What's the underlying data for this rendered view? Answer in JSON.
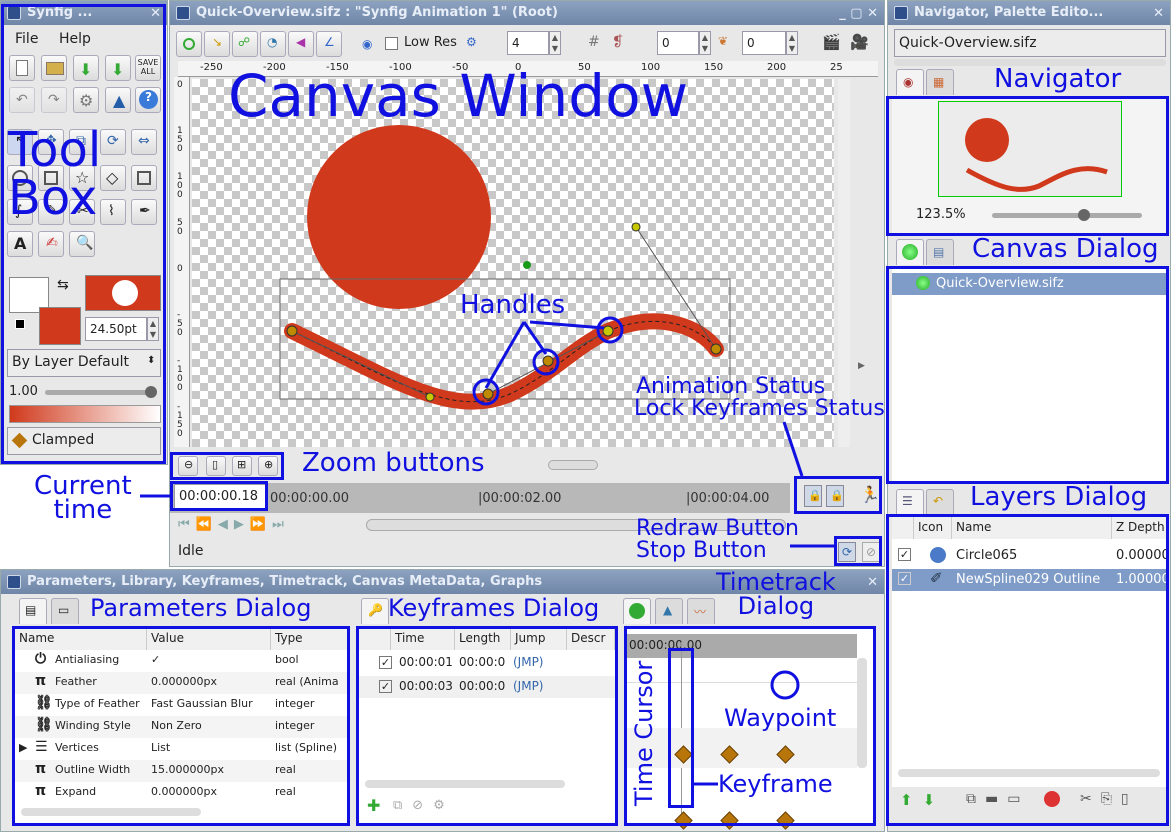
{
  "toolbox": {
    "title": "Synfig ...",
    "menu_file": "File",
    "menu_help": "Help",
    "save_all": "SAVE\nALL",
    "width": "24.50pt",
    "blend": "By Layer Default",
    "opacity": "1.00",
    "interp": "Clamped"
  },
  "canvas": {
    "title": "Quick-Overview.sifz : \"Synfig Animation 1\" (Root)",
    "low_res": "Low Res",
    "res_value": "4",
    "onion_past": "0",
    "onion_future": "0",
    "ruler_h": [
      "-250",
      "-200",
      "-150",
      "-100",
      "-50",
      "0",
      "50",
      "100",
      "150",
      "200",
      "25"
    ],
    "ruler_v": [
      "0",
      "150",
      "100",
      "50",
      "0",
      "-50",
      "-100",
      "-150"
    ],
    "current_time": "00:00:00.18",
    "time_ticks": [
      "00:00:00.00",
      "|00:00:02.00",
      "|00:00:04.00"
    ],
    "status": "Idle"
  },
  "navigator": {
    "title": "Navigator, Palette Edito...",
    "file": "Quick-Overview.sifz",
    "zoom": "123.5%"
  },
  "canvas_dialog": {
    "file": "Quick-Overview.sifz"
  },
  "layers": {
    "headers": [
      "Icon",
      "Name",
      "Z Depth"
    ],
    "rows": [
      {
        "name": "Circle065",
        "z": "0.00000"
      },
      {
        "name": "NewSpline029 Outline",
        "z": "1.00000"
      }
    ]
  },
  "params": {
    "title": "Parameters, Library, Keyframes, Timetrack, Canvas MetaData, Graphs",
    "headers": [
      "Name",
      "Value",
      "Type"
    ],
    "rows": [
      {
        "icon": "⏻",
        "name": "Antialiasing",
        "value": "✓",
        "type": "bool"
      },
      {
        "icon": "π",
        "name": "Feather",
        "value": "0.000000px",
        "type": "real (Anima"
      },
      {
        "icon": "⛓",
        "name": "Type of Feather",
        "value": "Fast Gaussian Blur",
        "type": "integer"
      },
      {
        "icon": "⛓",
        "name": "Winding Style",
        "value": "Non Zero",
        "type": "integer"
      },
      {
        "icon": "☰",
        "name": "Vertices",
        "value": "List",
        "type": "list (Spline)"
      },
      {
        "icon": "π",
        "name": "Outline Width",
        "value": "15.000000px",
        "type": "real"
      },
      {
        "icon": "π",
        "name": "Expand",
        "value": "0.000000px",
        "type": "real"
      }
    ]
  },
  "keyframes": {
    "headers": [
      "Time",
      "Length",
      "Jump",
      "Descr"
    ],
    "rows": [
      {
        "time": "00:00:01",
        "length": "00:00:0",
        "jump": "(JMP)"
      },
      {
        "time": "00:00:03",
        "length": "00:00:0",
        "jump": "(JMP)"
      }
    ]
  },
  "timetrack": {
    "time": "00:00:00.00"
  },
  "annotations": {
    "toolbox": "Tool\nBox",
    "canvas_window": "Canvas Window",
    "navigator": "Navigator",
    "canvas_dialog": "Canvas Dialog",
    "handles": "Handles",
    "animation_status": "Animation Status",
    "lock_status": "Lock Keyframes Status",
    "zoom_buttons": "Zoom buttons",
    "current_time": "Current\ntime",
    "layers_dialog": "Layers Dialog",
    "redraw": "Redraw Button",
    "stop": "Stop  Button",
    "timetrack_dialog": "Timetrack\nDialog",
    "params_dialog": "Parameters Dialog",
    "keyframes_dialog": "Keyframes Dialog",
    "time_cursor": "Time Cursor",
    "waypoint": "Waypoint",
    "keyframe": "Keyframe"
  },
  "colors": {
    "accent": "#1010e0",
    "shape": "#d0391c",
    "titlebar": "#7a90b0"
  }
}
